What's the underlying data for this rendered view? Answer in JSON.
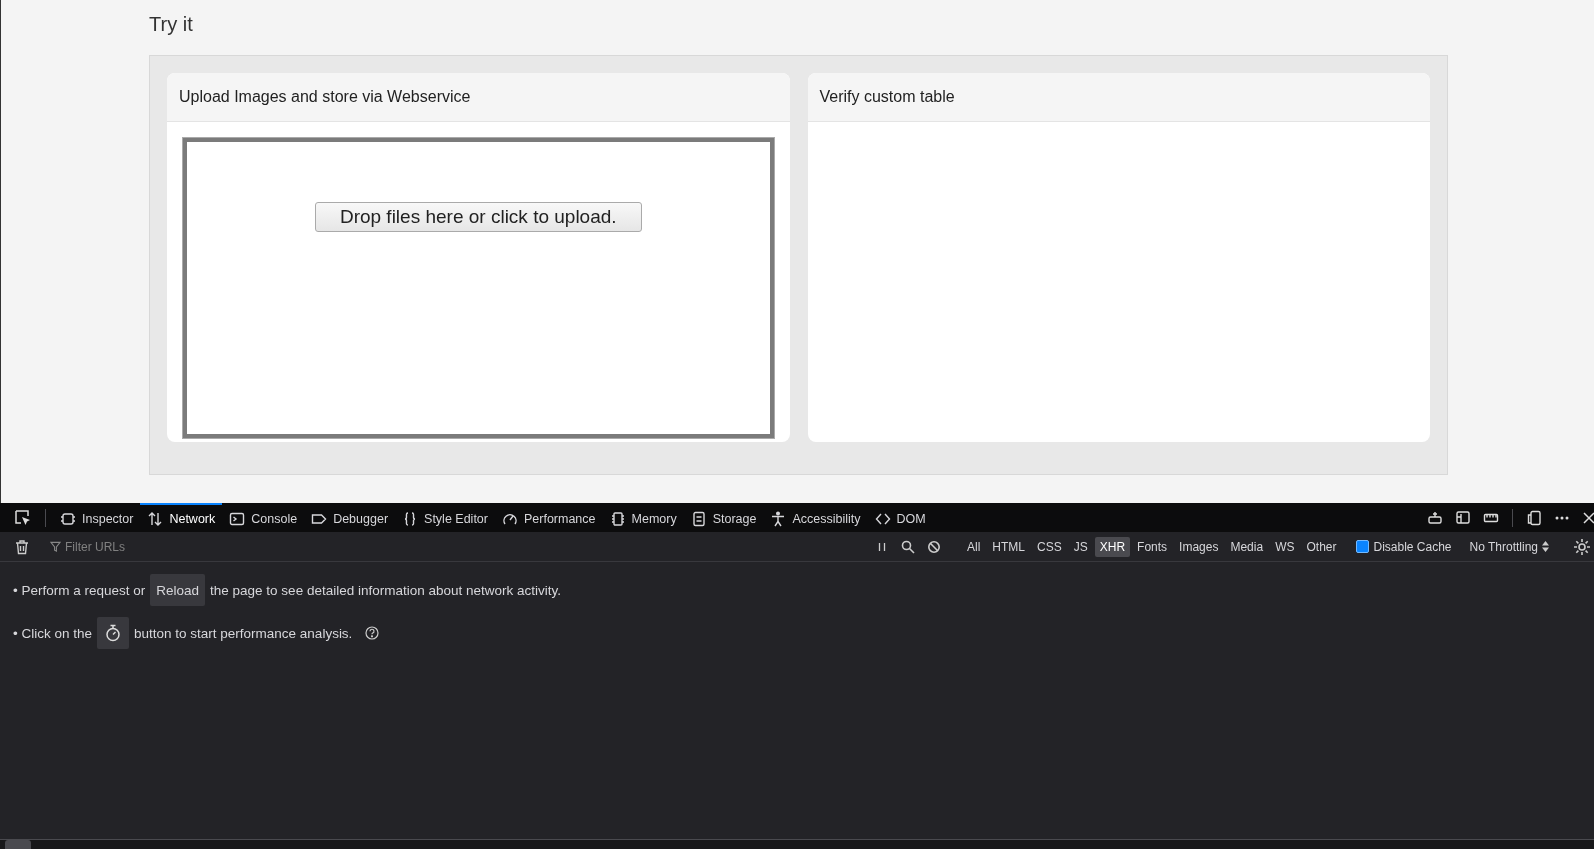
{
  "page": {
    "heading": "Try it",
    "cards": [
      {
        "kind": "upload",
        "title": "Upload Images and store via Webservice",
        "drop_button": "Drop files here or click to upload."
      },
      {
        "kind": "empty",
        "title": "Verify custom table"
      }
    ]
  },
  "devtools": {
    "tabs": [
      {
        "label": "Inspector",
        "selected": false
      },
      {
        "label": "Network",
        "selected": true
      },
      {
        "label": "Console",
        "selected": false
      },
      {
        "label": "Debugger",
        "selected": false
      },
      {
        "label": "Style Editor",
        "selected": false
      },
      {
        "label": "Performance",
        "selected": false
      },
      {
        "label": "Memory",
        "selected": false
      },
      {
        "label": "Storage",
        "selected": false
      },
      {
        "label": "Accessibility",
        "selected": false
      },
      {
        "label": "DOM",
        "selected": false
      }
    ],
    "filter": {
      "placeholder": "Filter URLs"
    },
    "type_filters": [
      {
        "label": "All",
        "selected": false
      },
      {
        "label": "HTML",
        "selected": false
      },
      {
        "label": "CSS",
        "selected": false
      },
      {
        "label": "JS",
        "selected": false
      },
      {
        "label": "XHR",
        "selected": true
      },
      {
        "label": "Fonts",
        "selected": false
      },
      {
        "label": "Images",
        "selected": false
      },
      {
        "label": "Media",
        "selected": false
      },
      {
        "label": "WS",
        "selected": false
      },
      {
        "label": "Other",
        "selected": false
      }
    ],
    "disable_cache": {
      "label": "Disable Cache",
      "checked": true
    },
    "throttling": "No Throttling",
    "messages": [
      {
        "kind": "reload",
        "before": "• Perform a request or",
        "button": "Reload",
        "after": "the page to see detailed information about network activity."
      },
      {
        "kind": "perf",
        "before": "• Click on the",
        "after": "button to start performance analysis."
      }
    ]
  }
}
